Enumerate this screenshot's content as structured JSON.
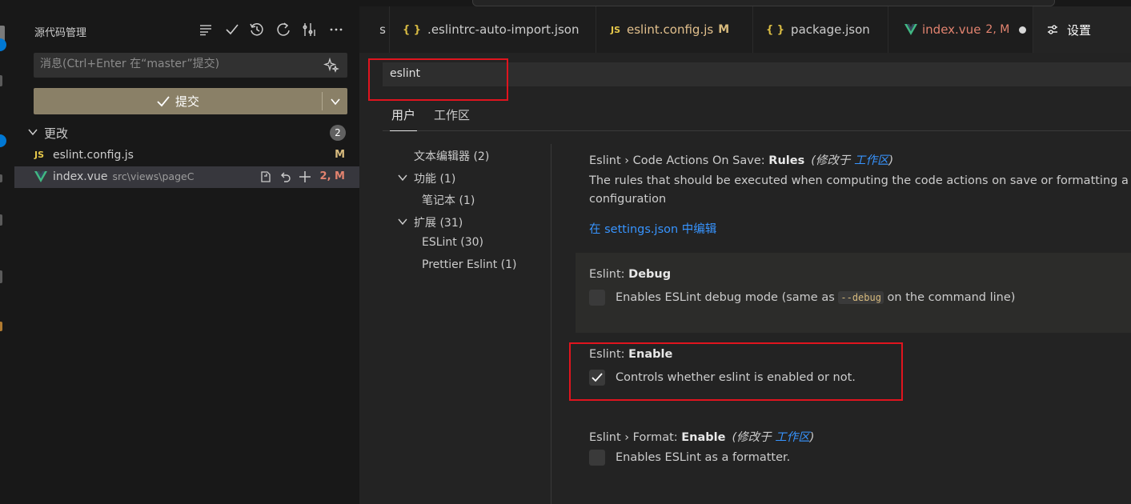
{
  "scm": {
    "title": "源代码管理",
    "message_placeholder": "消息(Ctrl+Enter 在“master”提交)",
    "commit_label": "提交",
    "changes_label": "更改",
    "changes_count": "2",
    "files": [
      {
        "name": "eslint.config.js",
        "path": "",
        "status": "M",
        "icon": "js-icon"
      },
      {
        "name": "index.vue",
        "path": "src\\views\\pageC",
        "status": "2, M",
        "icon": "vue-icon"
      }
    ]
  },
  "tabs": [
    {
      "label": "s"
    },
    {
      "label": ".eslintrc-auto-import.json",
      "icon": "json-icon"
    },
    {
      "label": "eslint.config.js",
      "status": "M",
      "icon": "js-icon"
    },
    {
      "label": "package.json",
      "icon": "json-icon"
    },
    {
      "label": "index.vue",
      "status": "2, M",
      "icon": "vue-icon"
    },
    {
      "label": "设置",
      "icon": "settings-icon"
    }
  ],
  "settings": {
    "search_value": "eslint",
    "scope_tabs": [
      "用户",
      "工作区"
    ],
    "toc": [
      {
        "label": "文本编辑器 (2)"
      },
      {
        "label": "功能 (1)"
      },
      {
        "label": "笔记本 (1)"
      },
      {
        "label": "扩展 (31)"
      },
      {
        "label": "ESLint (30)"
      },
      {
        "label": "Prettier Eslint (1)"
      }
    ],
    "items": [
      {
        "prefix": "Eslint › Code Actions On Save: ",
        "name": "Rules",
        "modified_prefix": "(修改于 ",
        "modified_link": "工作区",
        "modified_suffix": ")",
        "description": "The rules that should be executed when computing the code actions on save or formatting a fil",
        "description2": "configuration",
        "link": "在 settings.json 中编辑"
      },
      {
        "prefix": "Eslint: ",
        "name": "Debug",
        "desc_before": "Enables ESLint debug mode (same as ",
        "desc_code": "--debug",
        "desc_after": " on the command line)",
        "checked": false
      },
      {
        "prefix": "Eslint: ",
        "name": "Enable",
        "description": "Controls whether eslint is enabled or not.",
        "checked": true
      },
      {
        "prefix": "Eslint › Format: ",
        "name": "Enable",
        "modified_prefix": "(修改于 ",
        "modified_link": "工作区",
        "modified_suffix": ")",
        "description": "Enables ESLint as a formatter.",
        "checked": false
      }
    ]
  },
  "colors": {
    "accent": "#0078d4",
    "commit_button": "#8a8067",
    "modified": "#d7ba7d",
    "error": "#e2836f",
    "highlight_box": "#e0141e",
    "vue_green": "#41b883"
  }
}
